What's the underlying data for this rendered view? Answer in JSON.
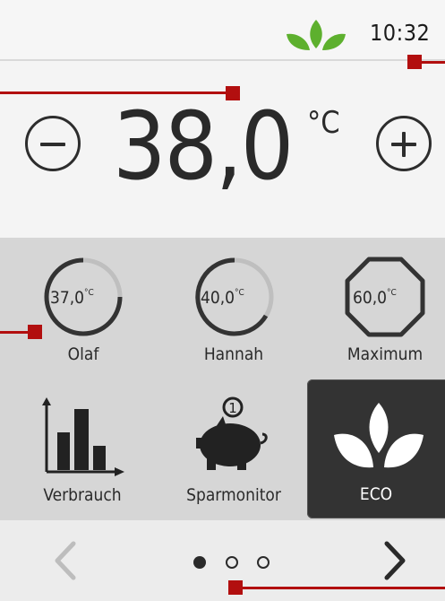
{
  "status_bar": {
    "time": "10:32",
    "icons": [
      "leaf-logo-icon"
    ]
  },
  "temperature": {
    "value": "38,0",
    "unit": "°C"
  },
  "profiles": [
    {
      "label": "Olaf",
      "value": "37,0",
      "unit": "°C",
      "ring": "partial"
    },
    {
      "label": "Hannah",
      "value": "40,0",
      "unit": "°C",
      "ring": "partial"
    },
    {
      "label": "Maximum",
      "value": "60,0",
      "unit": "°C",
      "ring": "octagon"
    }
  ],
  "tiles": [
    {
      "label": "Verbrauch",
      "icon": "bar-chart-icon"
    },
    {
      "label": "Sparmonitor",
      "icon": "piggy-bank-icon",
      "badge": "1"
    },
    {
      "label": "ECO",
      "icon": "eco-leaves-icon",
      "selected": true
    }
  ],
  "pagination": {
    "pages": 3,
    "current": 1
  },
  "colors": {
    "accent_green": "#5db02e",
    "annotation_red": "#b20f0f",
    "panel_gray": "#d6d6d6",
    "eco_tile": "#333333"
  }
}
